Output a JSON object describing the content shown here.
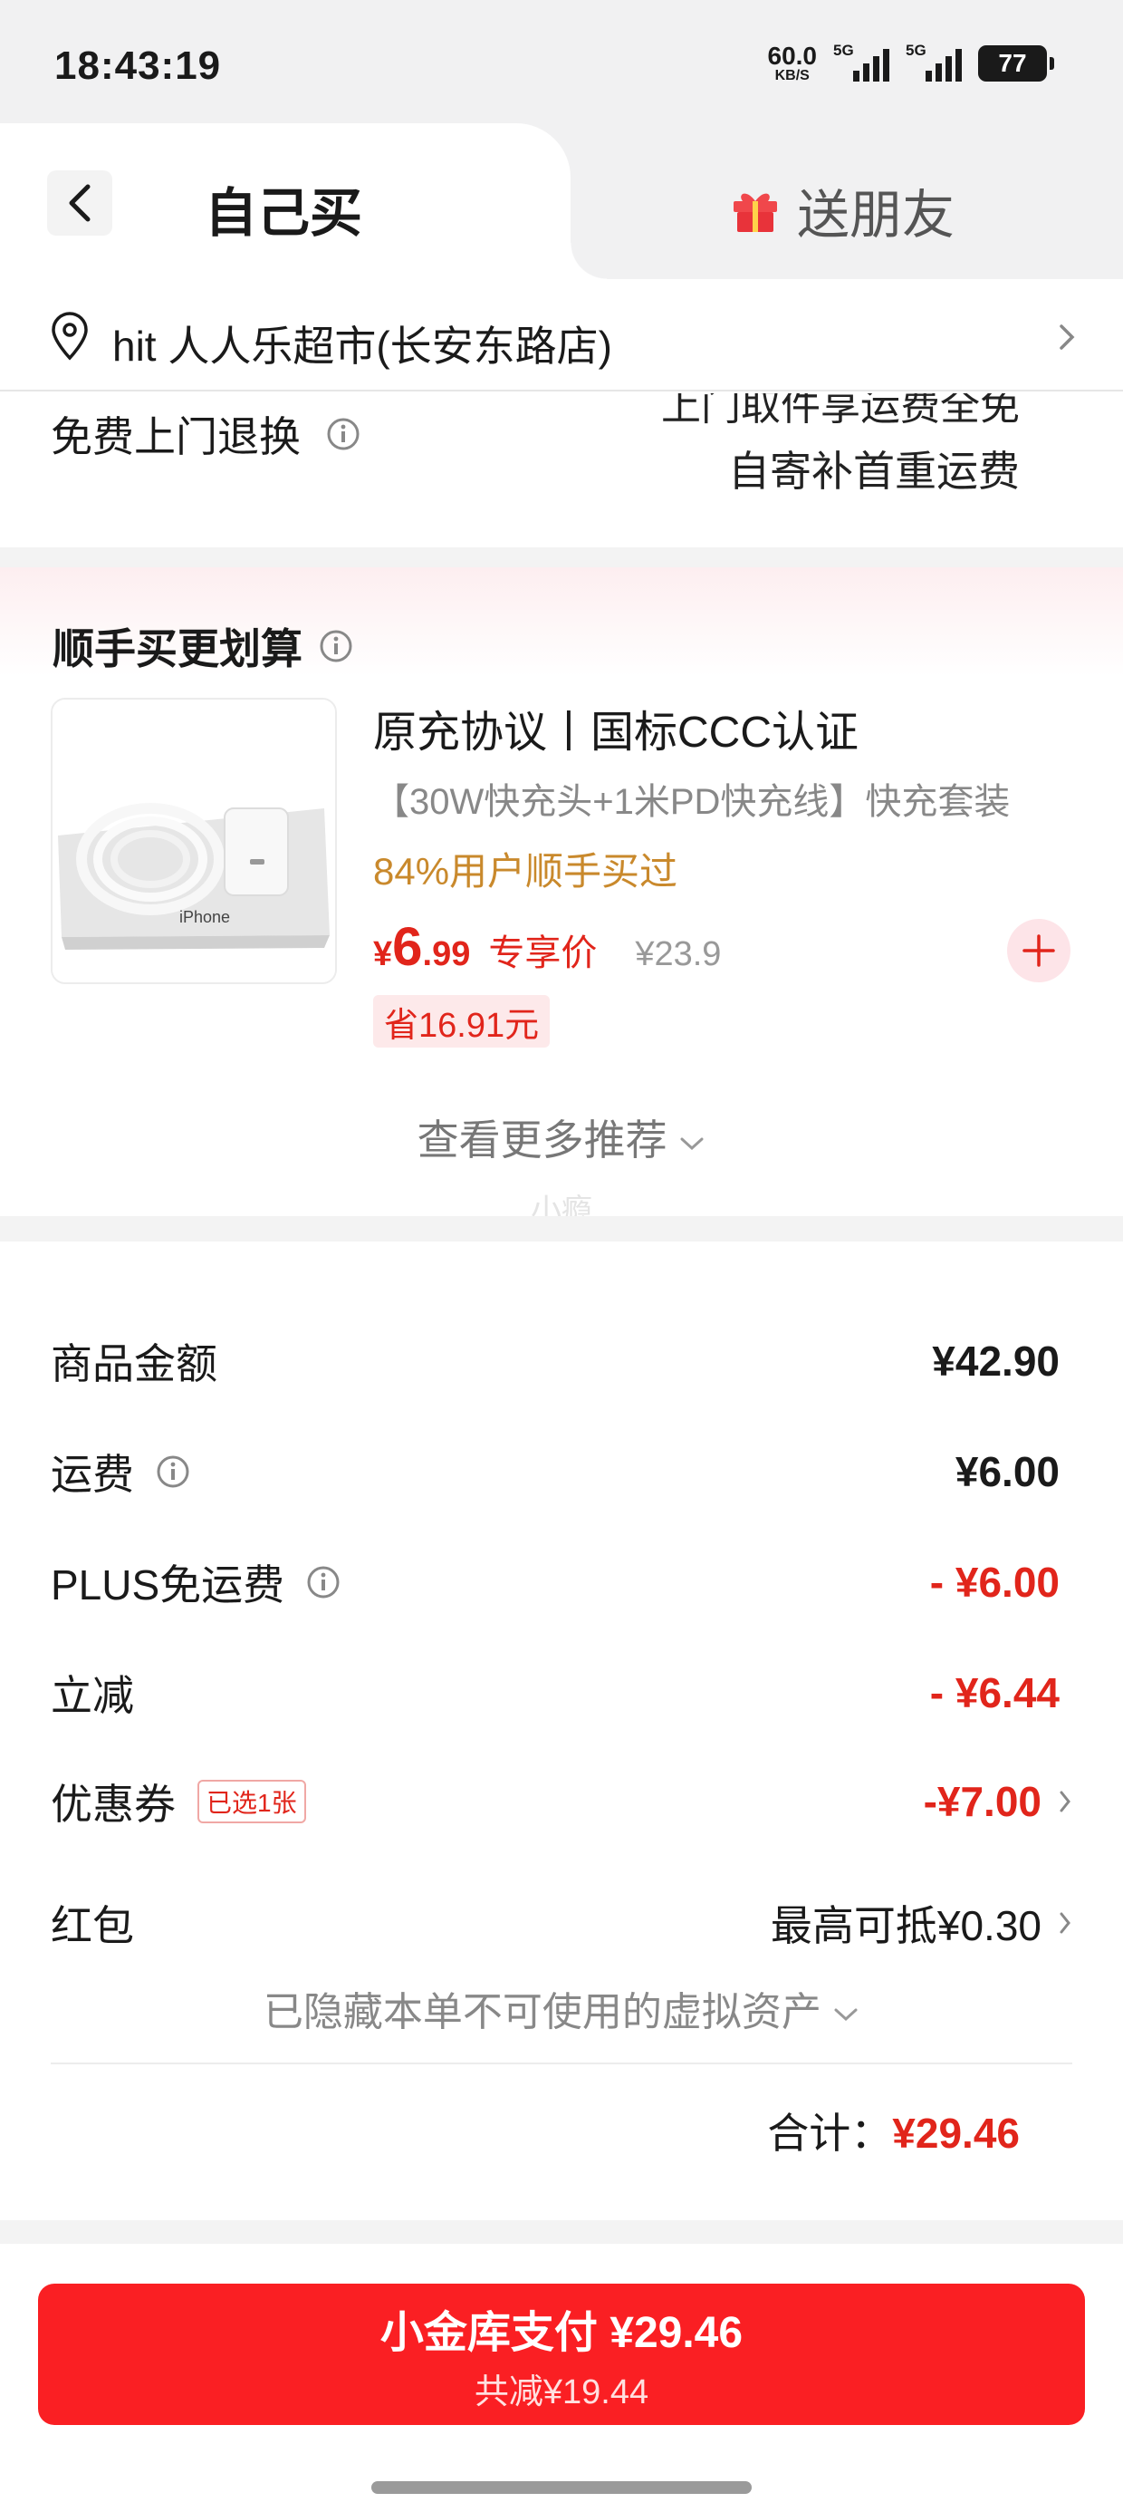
{
  "status_bar": {
    "time": "18:43:19",
    "net_speed": "60.0",
    "net_unit": "KB/S",
    "signal1_label": "5G",
    "signal2_label": "5G",
    "battery": "77"
  },
  "tabs": {
    "active_label": "自己买",
    "gift_label": "送朋友"
  },
  "address": {
    "text": "hit  人人乐超市(长安东路店)"
  },
  "return_service": {
    "label": "免费上门退换",
    "line1": "上门取件享运费全免",
    "line2": "自寄补首重运费"
  },
  "recommend": {
    "title": "顺手买更划算",
    "product": {
      "name": "原充协议丨国标CCC认证",
      "desc": "【30W快充头+1米PD快充线】快充套装",
      "stat": "84%用户顺手买过",
      "price_currency": "¥",
      "price_int": "6",
      "price_dec": ".99",
      "price_tag": "专享价",
      "orig_price": "¥23.9",
      "save_badge": "省16.91元",
      "image_text": "iPhone"
    },
    "more_label": "查看更多推荐",
    "watermark": "小瘾"
  },
  "summary": {
    "goods_label": "商品金额",
    "goods_value": "¥42.90",
    "shipping_label": "运费",
    "shipping_value": "¥6.00",
    "plus_label": "PLUS免运费",
    "plus_value": "- ¥6.00",
    "instant_label": "立减",
    "instant_value": "- ¥6.44",
    "coupon_label": "优惠券",
    "coupon_badge": "已选1张",
    "coupon_value": "-¥7.00",
    "redpacket_label": "红包",
    "redpacket_value": "最高可抵¥0.30",
    "hidden_assets_label": "已隐藏本单不可使用的虚拟资产",
    "total_label": "合计：",
    "total_value": "¥29.46"
  },
  "pay": {
    "main_label": "小金库支付 ¥29.46",
    "sub_label": "共减¥19.44"
  },
  "colors": {
    "accent_red": "#e1251b",
    "pay_button": "#fa1f23",
    "stat_orange": "#c9892c"
  }
}
